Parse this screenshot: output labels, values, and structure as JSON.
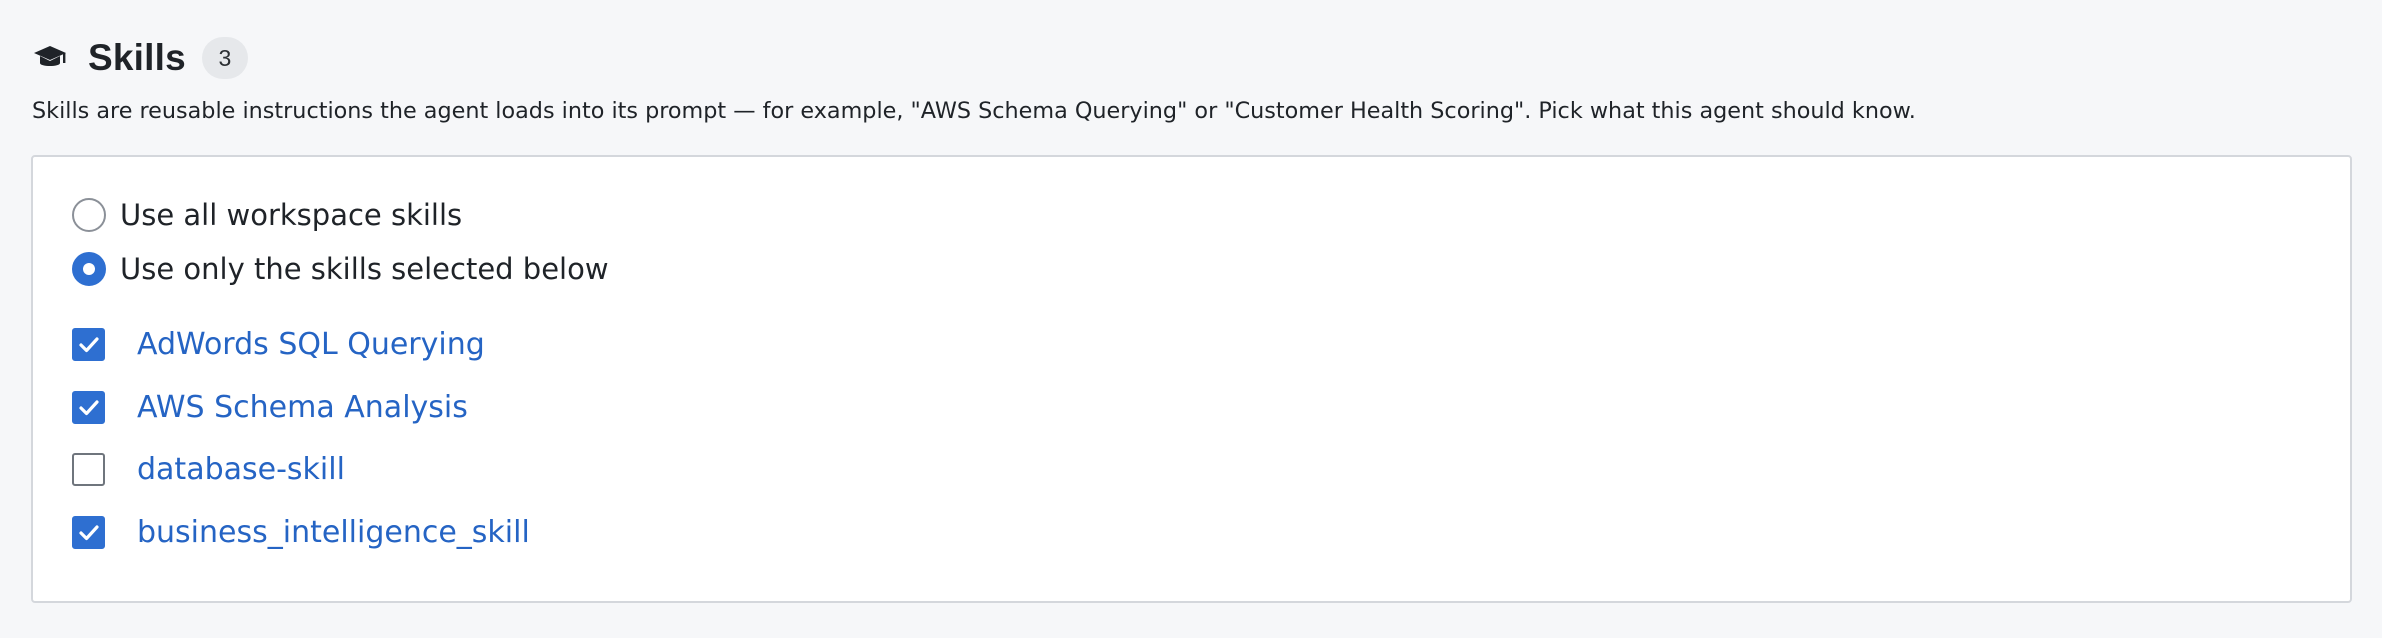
{
  "header": {
    "icon": "graduation-cap-icon",
    "title": "Skills",
    "count": "3"
  },
  "description": "Skills are reusable instructions the agent loads into its prompt — for example, \"AWS Schema Querying\" or \"Customer Health Scoring\". Pick what this agent should know.",
  "mode_options": [
    {
      "label": "Use all workspace skills",
      "selected": false
    },
    {
      "label": "Use only the skills selected below",
      "selected": true
    }
  ],
  "skills": [
    {
      "label": "AdWords SQL Querying",
      "checked": true
    },
    {
      "label": "AWS Schema Analysis",
      "checked": true
    },
    {
      "label": "database-skill",
      "checked": false
    },
    {
      "label": "business_intelligence_skill",
      "checked": true
    }
  ],
  "colors": {
    "accent": "#2e6fd1",
    "link": "#2564c4",
    "background": "#f6f7f9",
    "panel": "#ffffff"
  }
}
